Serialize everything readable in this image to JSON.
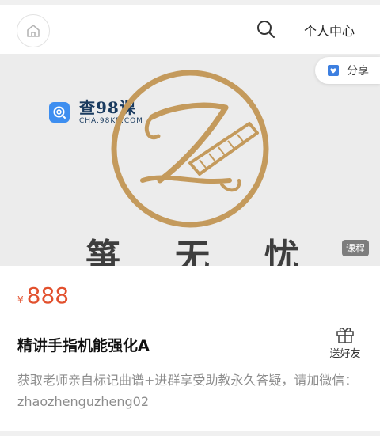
{
  "header": {
    "user_center": "个人中心"
  },
  "watermark": {
    "title": "查98课",
    "subtitle": "CHA.98KE.COM"
  },
  "share": {
    "label": "分享"
  },
  "hero": {
    "brand_chars": [
      "箏",
      "无",
      "忧"
    ],
    "badge": "课程"
  },
  "course": {
    "currency": "¥",
    "price": "888",
    "title": "精讲手指机能强化A",
    "gift_label": "送好友",
    "description": "获取老师亲自标记曲谱+进群享受助教永久答疑，请加微信：zhaozhenguzheng02"
  },
  "colors": {
    "accent_price": "#e2502d",
    "logo_gold": "#c49a5c",
    "watermark_blue": "#3d8ef0"
  }
}
